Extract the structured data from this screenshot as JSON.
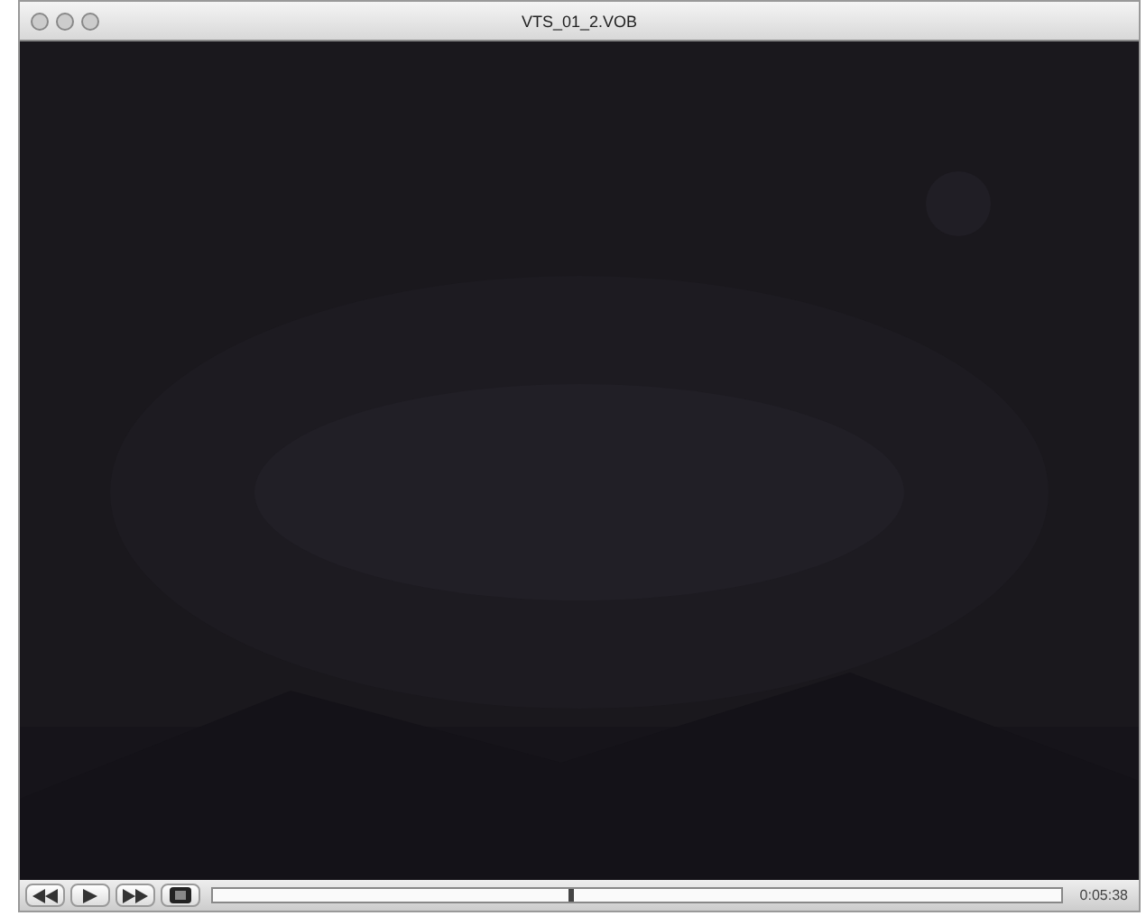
{
  "window": {
    "title": "VTS_01_2.VOB"
  },
  "controls": {
    "buttons": [
      {
        "kind": "rewind"
      },
      {
        "kind": "play"
      },
      {
        "kind": "forward"
      },
      {
        "kind": "screen"
      }
    ],
    "progress": {
      "level": 0.42
    },
    "time": "0:05:38"
  }
}
